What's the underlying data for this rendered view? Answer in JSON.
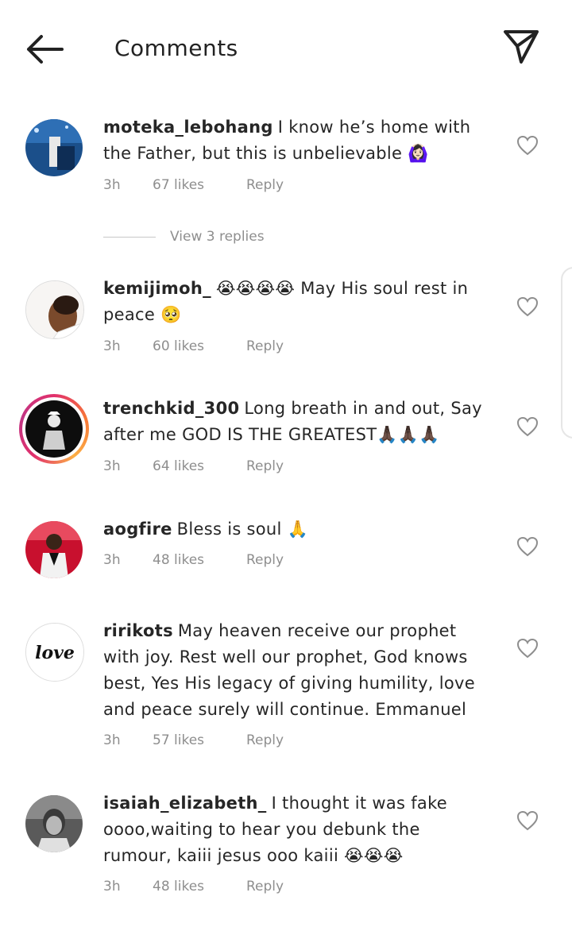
{
  "header": {
    "title": "Comments",
    "back_icon": "arrow-left-icon",
    "send_icon": "paper-plane-icon"
  },
  "comments": [
    {
      "username": "moteka_lebohang",
      "text": "I know he’s home with the Father, but this is unbelievable 🙆🏻‍♀️",
      "time": "3h",
      "likes": "67 likes",
      "reply": "Reply"
    },
    {
      "username": "kemijimoh_",
      "text": "😭😭😭😭 May His soul rest in peace 🥺",
      "time": "3h",
      "likes": "60 likes",
      "reply": "Reply"
    },
    {
      "username": "trenchkid_300",
      "text": "Long breath in and out, Say after me GOD IS THE GREATEST🙏🏿🙏🏿🙏🏿",
      "time": "3h",
      "likes": "64 likes",
      "reply": "Reply"
    },
    {
      "username": "aogfire",
      "text": "Bless is soul 🙏",
      "time": "3h",
      "likes": "48 likes",
      "reply": "Reply"
    },
    {
      "username": "ririkots",
      "text": "May heaven receive our prophet with joy. Rest well our prophet, God knows best, Yes His legacy of giving humility, love and peace surely will continue. Emmanuel",
      "time": "3h",
      "likes": "57 likes",
      "reply": "Reply"
    },
    {
      "username": "isaiah_elizabeth_",
      "text": "I thought it was fake oooo,waiting to hear you debunk the rumour, kaiii jesus ooo  kaiii 😭😭😭",
      "time": "3h",
      "likes": "48 likes",
      "reply": "Reply"
    }
  ],
  "view_replies": "View 3 replies",
  "avatar_logo_text": "love",
  "colors": {
    "text": "#262626",
    "secondary": "#8e8e8e",
    "story_ring": "#e1306c"
  }
}
